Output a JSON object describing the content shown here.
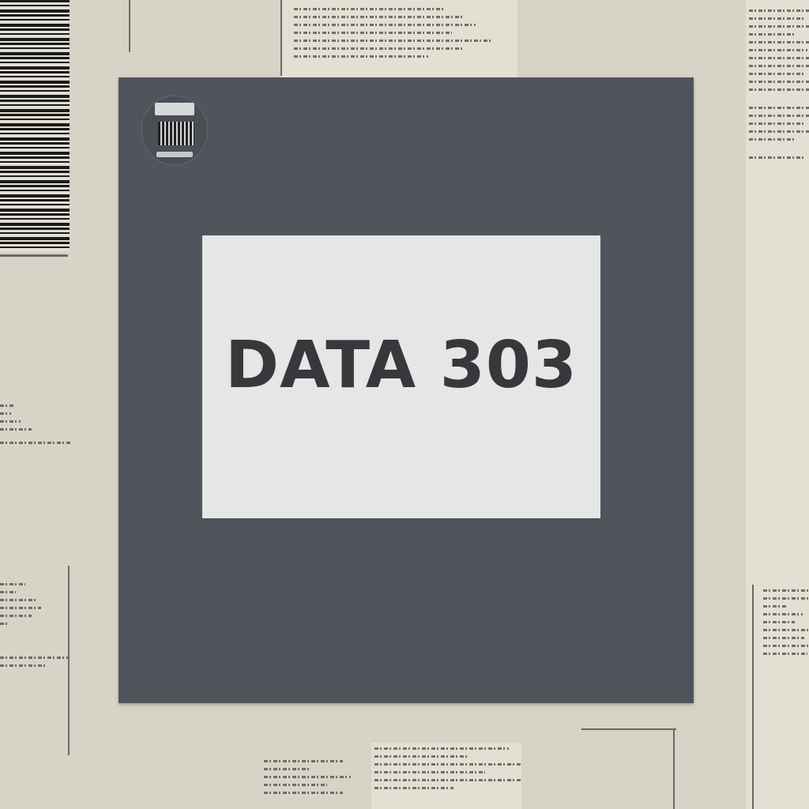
{
  "card": {
    "title": "DATA 303"
  }
}
